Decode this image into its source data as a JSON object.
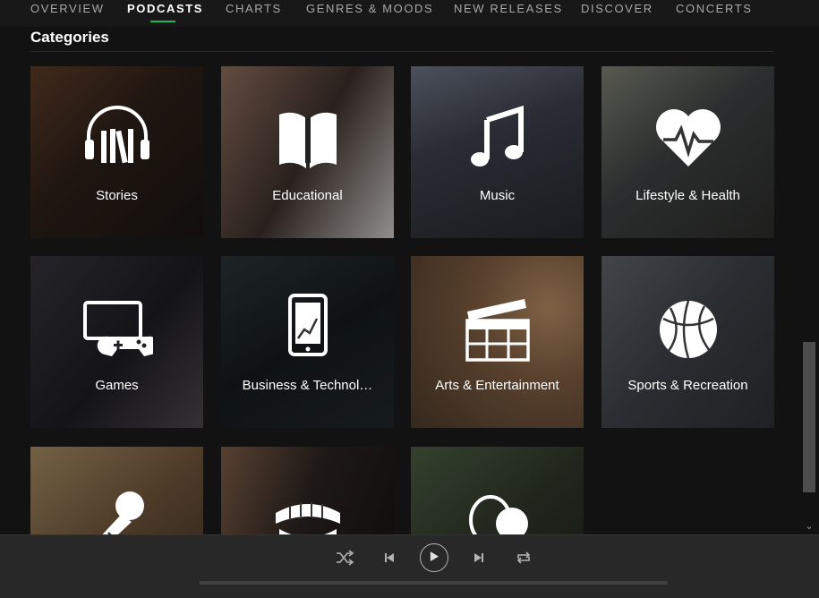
{
  "nav": {
    "tabs": [
      {
        "label": "OVERVIEW",
        "active": false
      },
      {
        "label": "PODCASTS",
        "active": true
      },
      {
        "label": "CHARTS",
        "active": false
      },
      {
        "label": "GENRES & MOODS",
        "active": false
      },
      {
        "label": "NEW RELEASES",
        "active": false
      },
      {
        "label": "DISCOVER",
        "active": false
      },
      {
        "label": "CONCERTS",
        "active": false
      }
    ]
  },
  "main": {
    "heading": "Categories",
    "categories": [
      {
        "label": "Stories",
        "icon": "headphones-books-icon",
        "tone": "#3a2a20"
      },
      {
        "label": "Educational",
        "icon": "open-book-icon",
        "tone": "#4a3a32"
      },
      {
        "label": "Music",
        "icon": "music-note-icon",
        "tone": "#3d4250"
      },
      {
        "label": "Lifestyle & Health",
        "icon": "heart-pulse-icon",
        "tone": "#3e4446"
      },
      {
        "label": "Games",
        "icon": "gamepad-monitor-icon",
        "tone": "#2a2a30"
      },
      {
        "label": "Business & Technol…",
        "icon": "phone-chart-icon",
        "tone": "#1e2428"
      },
      {
        "label": "Arts & Entertainment",
        "icon": "clapperboard-icon",
        "tone": "#6b4a30"
      },
      {
        "label": "Sports & Recreation",
        "icon": "basketball-icon",
        "tone": "#404448"
      },
      {
        "label": "",
        "icon": "microphone-icon",
        "tone": "#6a5138"
      },
      {
        "label": "",
        "icon": "teeth-icon",
        "tone": "#2a2320"
      },
      {
        "label": "",
        "icon": "speech-bubbles-icon",
        "tone": "#344030"
      }
    ]
  },
  "player": {
    "controls": [
      "shuffle-icon",
      "previous-icon",
      "play-icon",
      "next-icon",
      "repeat-icon"
    ]
  },
  "colors": {
    "accent": "#1db954",
    "background": "#121212",
    "player": "#282828"
  }
}
